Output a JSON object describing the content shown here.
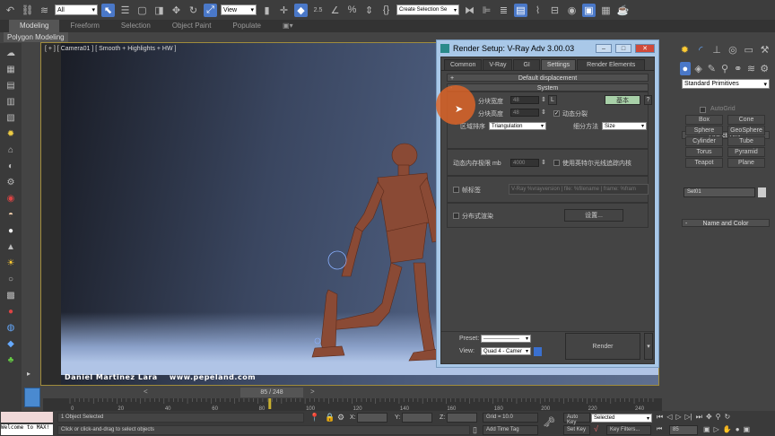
{
  "toolbar": {
    "selection_filter": "All",
    "ref_coord": "View",
    "named_selection": "Create Selection Se",
    "snap_angle": "2.5"
  },
  "ribbon": {
    "tabs": [
      "Modeling",
      "Freeform",
      "Selection",
      "Object Paint",
      "Populate"
    ],
    "active": "Modeling",
    "sub": "Polygon Modeling"
  },
  "viewport": {
    "label": "[ + ] [ Camera01 ] [ Smooth + Highlights + HW ]",
    "credit": "Daniel Martinez Lara    www.pepeland.com"
  },
  "dialog": {
    "title": "Render Setup: V-Ray Adv 3.00.03",
    "tabs": [
      "Common",
      "V-Ray",
      "GI",
      "Settings",
      "Render Elements"
    ],
    "active_tab": "Settings",
    "rollouts": {
      "default_displacement": "Default displacement",
      "system": "System"
    },
    "system": {
      "bucket_width_label": "分块宽度",
      "bucket_width": "48",
      "lock_label": "L",
      "bucket_height_label": "分块高度",
      "bucket_height": "48",
      "basic_button": "基本",
      "help_button": "?",
      "dynamic_split_label": "动态分裂",
      "dynamic_split": true,
      "sequence_label": "区域排序",
      "sequence": "Triangulation",
      "division_label": "细分方法",
      "division": "Size",
      "mem_limit_label": "动态内存极限 mb",
      "mem_limit": "4000",
      "embree_label": "使用英特尔光线追踪内核",
      "embree": false,
      "frame_stamp_label": "帧标签",
      "frame_stamp": false,
      "frame_stamp_text": "V-Ray %vrayversion | file: %filename | frame: %fram",
      "distributed_label": "分布式渲染",
      "distributed": false,
      "settings_button": "设置..."
    },
    "preset_label": "Preset:",
    "preset": "--------------------",
    "view_label": "View:",
    "view": "Quad 4 - Camer",
    "render_button": "Render"
  },
  "command_panel": {
    "category": "Standard Primitives",
    "object_type_title": "Object Type",
    "autogrid": "AutoGrid",
    "buttons": [
      "Box",
      "Cone",
      "Sphere",
      "GeoSphere",
      "Cylinder",
      "Tube",
      "Torus",
      "Pyramid",
      "Teapot",
      "Plane"
    ],
    "name_color_title": "Name and Color",
    "name": "Set01"
  },
  "timeline": {
    "frame": "85 / 248",
    "ticks": [
      "0",
      "20",
      "40",
      "60",
      "80",
      "100",
      "120",
      "140",
      "160",
      "180",
      "200",
      "220",
      "240"
    ],
    "current": 85,
    "total": 248
  },
  "status": {
    "maxscript": "Welcome to MAX!",
    "selected": "1 Object Selected",
    "prompt": "Click or click-and-drag to select objects",
    "x_label": "X:",
    "y_label": "Y:",
    "z_label": "Z:",
    "grid": "Grid = 10.0",
    "add_time_tag": "Add Time Tag",
    "auto_key": "Auto Key",
    "set_key": "Set Key",
    "key_mode": "Selected",
    "key_filters": "Key Filters...",
    "frame_field": "85"
  }
}
